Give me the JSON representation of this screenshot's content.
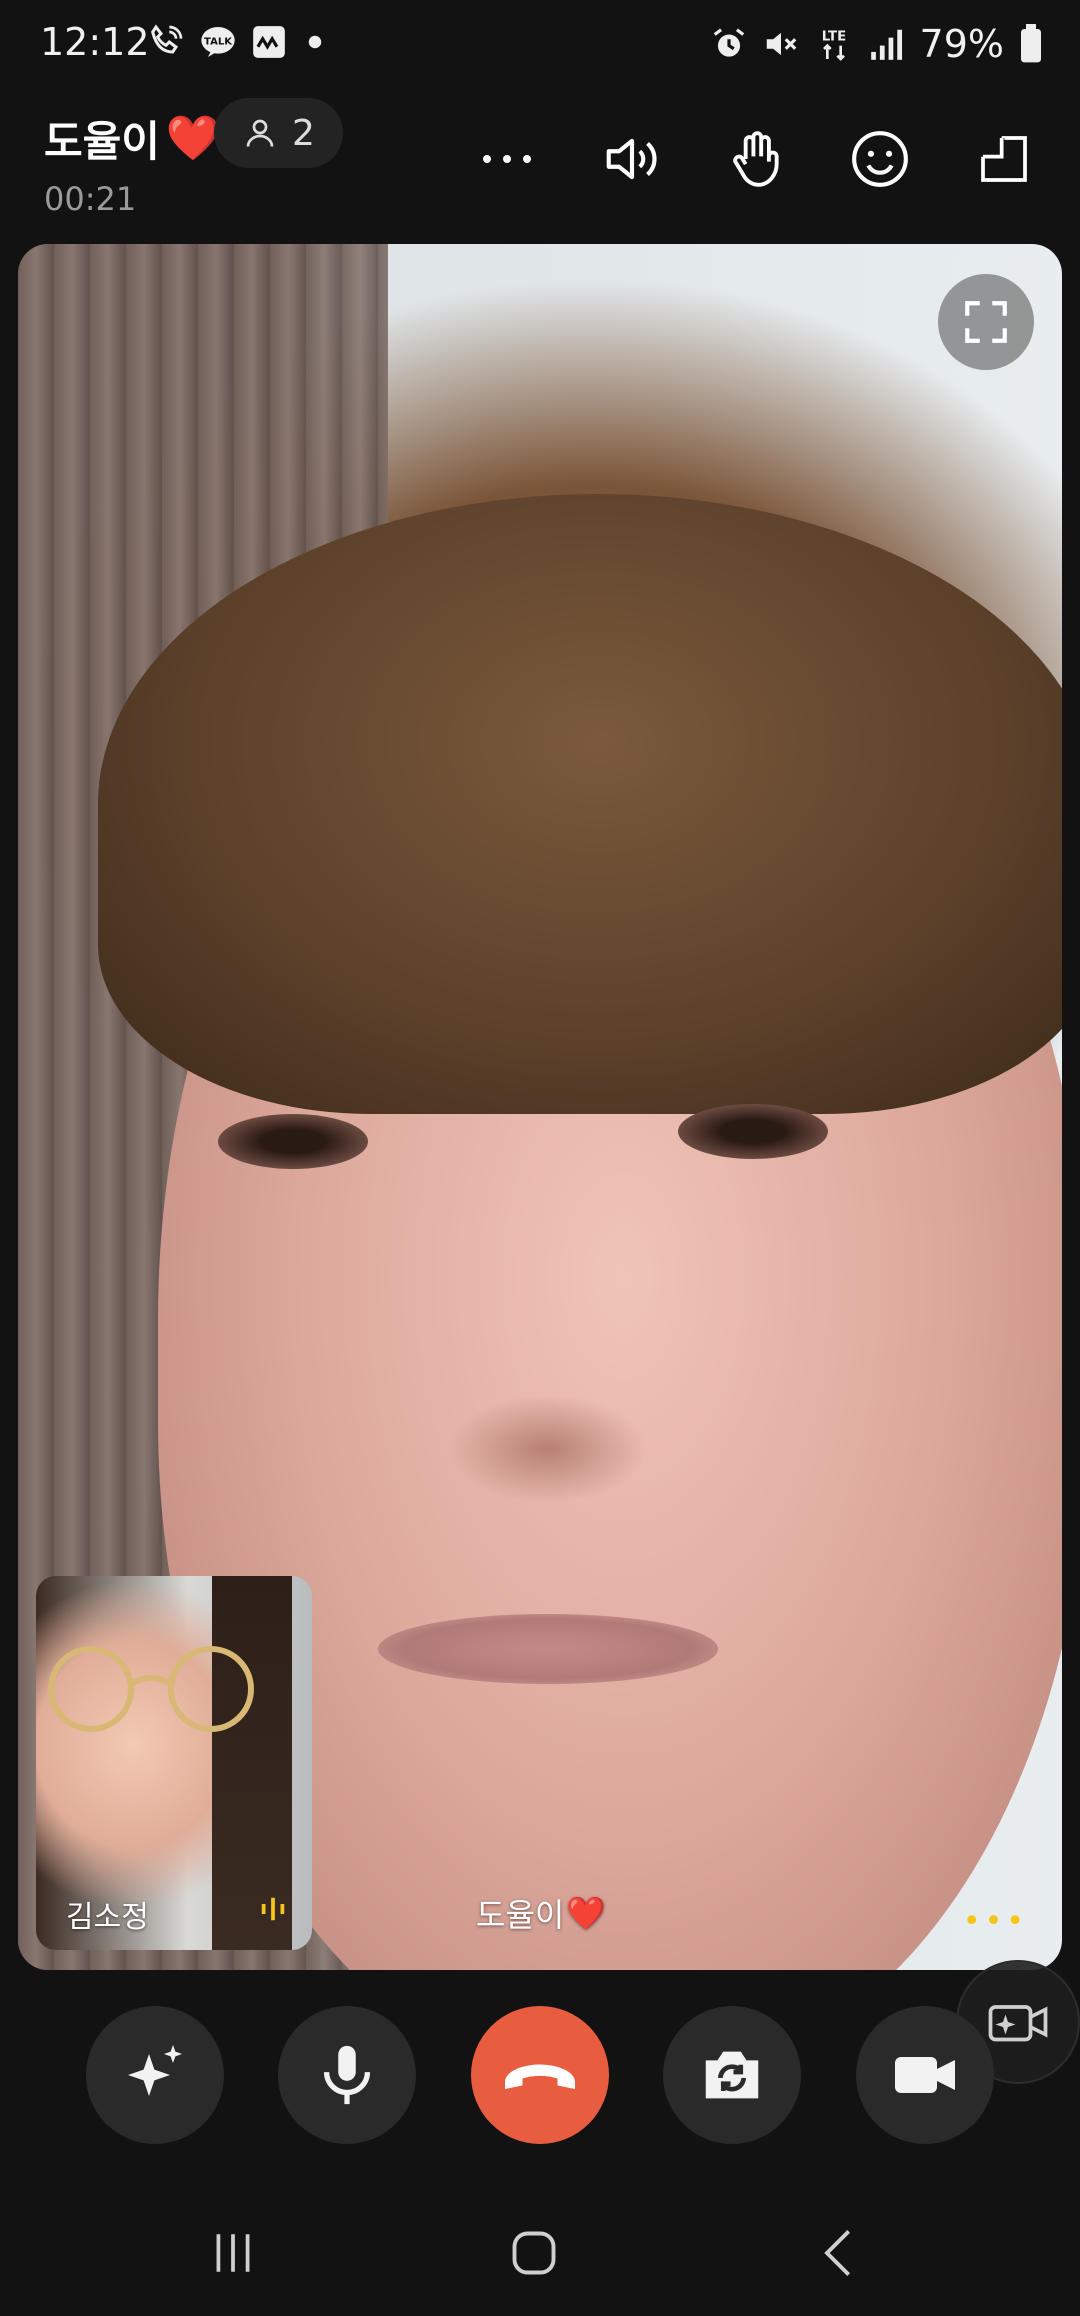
{
  "status_bar": {
    "time": "12:12",
    "battery": "79%",
    "network": "LTE",
    "left_icons": [
      "call-icon",
      "kakaotalk-icon",
      "kakao-notification-icon",
      "dot-icon"
    ],
    "right_icons": [
      "alarm-icon",
      "mute-icon",
      "lte-icon",
      "signal-icon",
      "battery-icon"
    ]
  },
  "header": {
    "title": "도율이",
    "title_emoji": "❤️",
    "participants_count": "2",
    "duration": "00:21",
    "buttons": [
      "more-icon",
      "speaker-icon",
      "raise-hand-icon",
      "emoji-icon",
      "pip-icon"
    ]
  },
  "main_video": {
    "remote_name": "도율이",
    "remote_emoji": "❤️",
    "more_indicator": "•••"
  },
  "self_preview": {
    "name": "김소정"
  },
  "controls": {
    "items": [
      "effects-icon",
      "microphone-icon",
      "end-call-icon",
      "switch-camera-icon",
      "video-icon"
    ],
    "end_color": "#e85d3f"
  },
  "colors": {
    "background": "#121212",
    "button_bg": "#2a2a2a",
    "accent_yellow": "#f5c518",
    "heart": "#ff2a3d"
  }
}
